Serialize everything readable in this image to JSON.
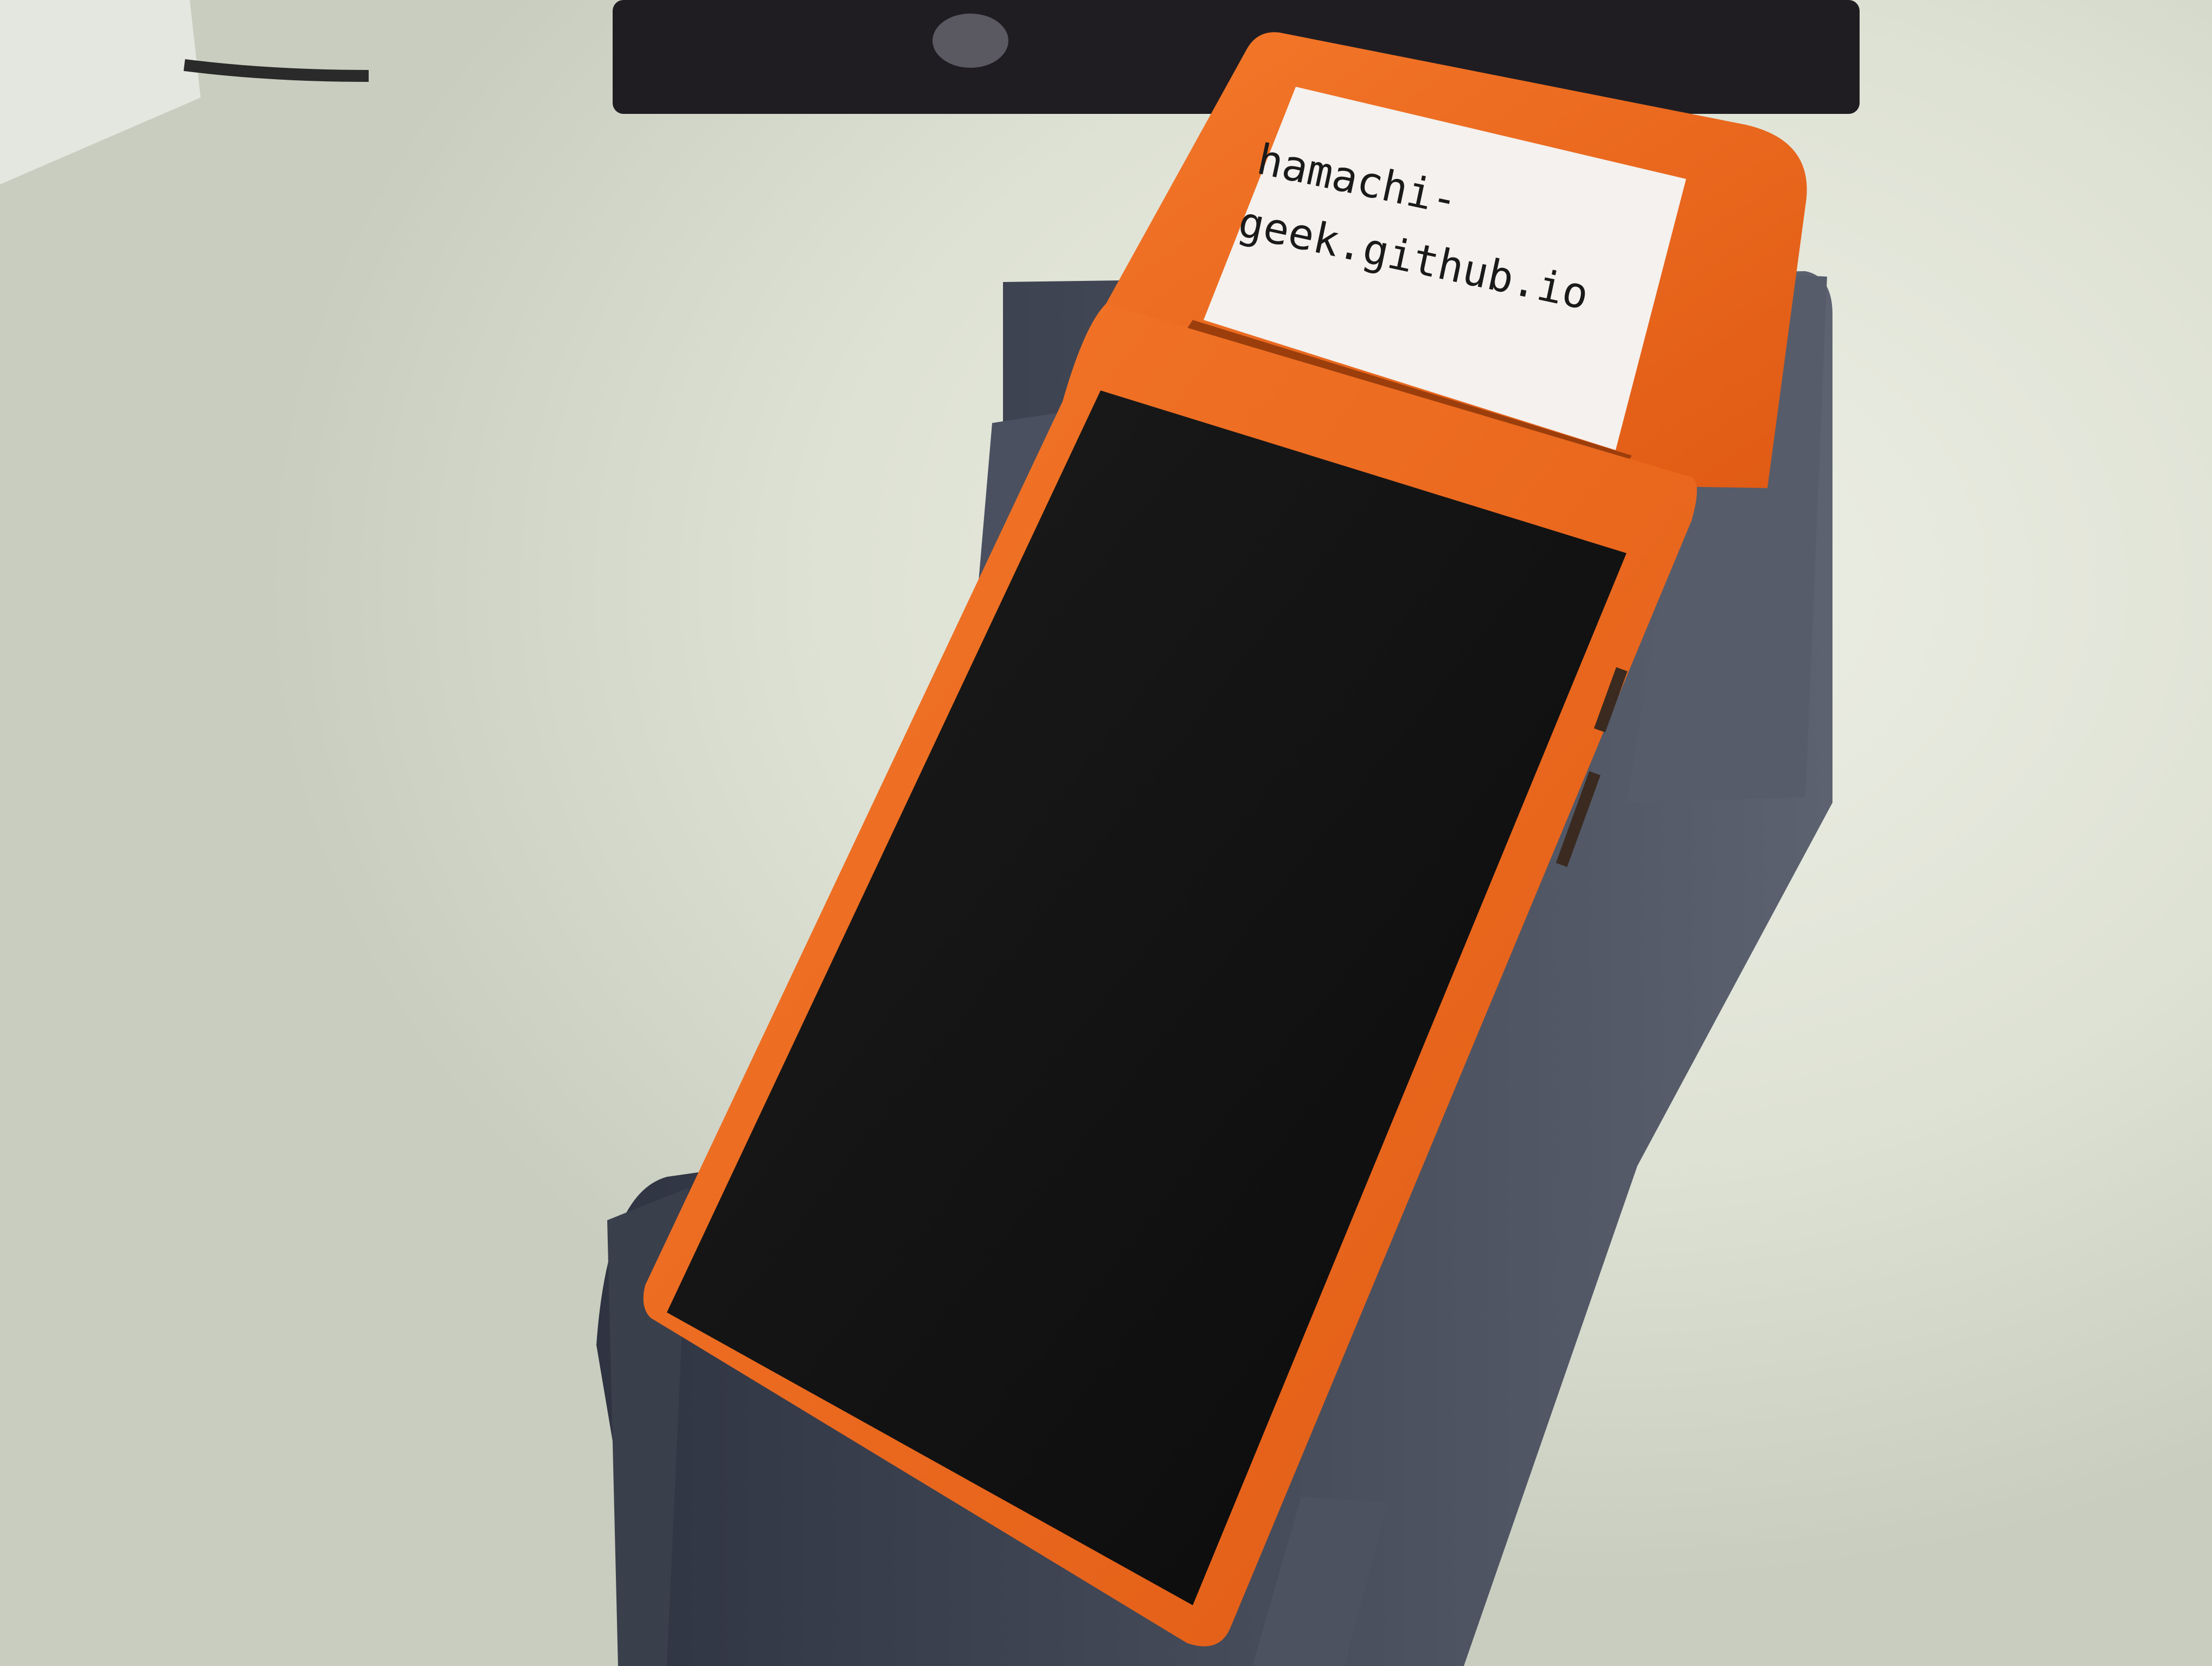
{
  "receipt": {
    "line1": "hamachi-",
    "line2": "geek.github.io"
  },
  "colors": {
    "device_body": "#f26a1f",
    "screen": "#111111",
    "dock": "#3d4250",
    "paper": "#f4f1ee",
    "desk": "#d9ddd0"
  }
}
